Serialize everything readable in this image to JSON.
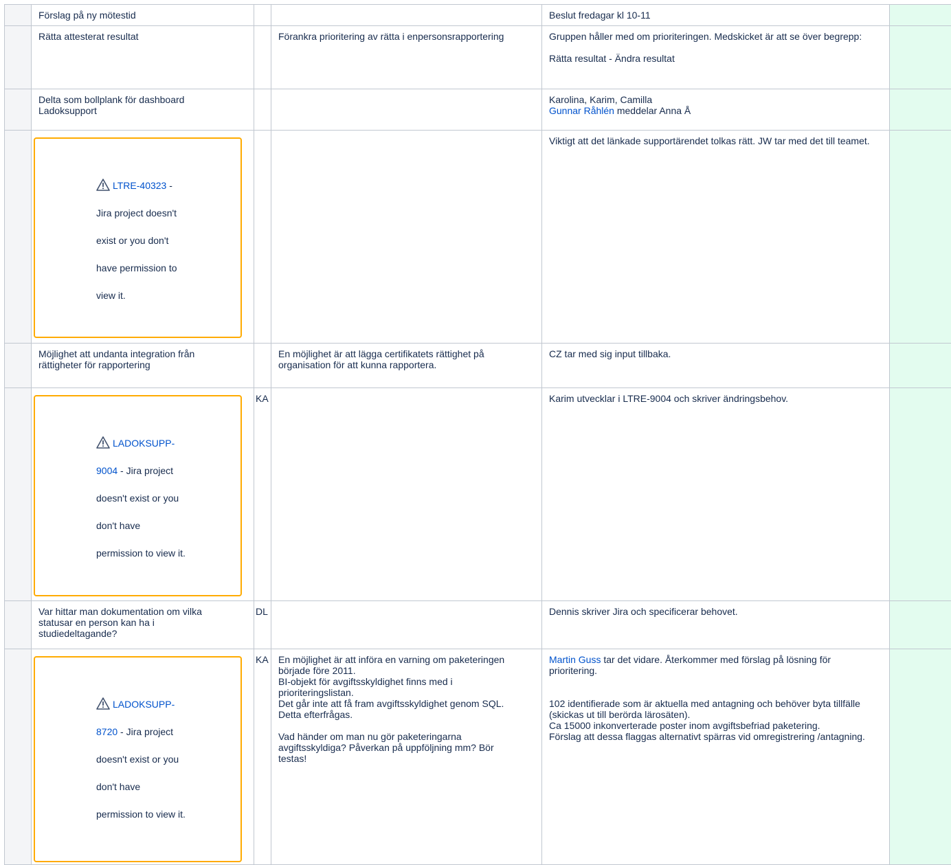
{
  "rows": [
    {
      "topic": "Förslag på ny mötestid",
      "who": "",
      "discussion": [],
      "decision": [
        {
          "text": "Beslut fredagar kl 10-11"
        }
      ]
    },
    {
      "topic": "Rätta attesterat resultat",
      "who": "",
      "discussion": [
        "Förankra prioritering av rätta i enpersonsrapportering"
      ],
      "decision": [
        {
          "text": "Gruppen håller med om prioriteringen. Medskicket är att se över begrepp:"
        },
        {
          "gap": true
        },
        {
          "text": "Rätta resultat - Ändra resultat"
        }
      ]
    },
    {
      "topic": "Delta som bollplank för dashboard Ladoksupport",
      "who": "",
      "discussion": [],
      "decision_line1": "Karolina, Karim, Camilla",
      "decision_link": "Gunnar Råhlén",
      "decision_after_link": " meddelar Anna Å"
    },
    {
      "jira_lines": [
        "LTRE-40323",
        " -",
        "Jira project doesn't",
        "exist or you don't",
        "have permission to",
        "view it."
      ],
      "who": "",
      "decision": "Viktigt att det länkade supportärendet tolkas rätt. JW tar med det till teamet."
    },
    {
      "topic": "Möjlighet att undanta integration från rättigheter för rapportering",
      "who": "",
      "discussion": "En möjlighet är att lägga certifikatets rättighet på organisation för att kunna rapportera.",
      "decision": "CZ tar med sig input tillbaka."
    },
    {
      "jira_lines": [
        "LADOKSUPP-",
        "9004",
        " - Jira project",
        "doesn't exist or you",
        "don't have",
        "permission to view it."
      ],
      "who": "KA",
      "decision": "Karim utvecklar i LTRE-9004 och skriver ändringsbehov."
    },
    {
      "topic": "Var hittar man dokumentation om vilka statusar en person kan ha i studiedeltagande?",
      "who": "DL",
      "decision": "Dennis skriver Jira och specificerar behovet."
    },
    {
      "jira_lines": [
        "LADOKSUPP-",
        "8720",
        " - Jira project",
        "doesn't exist or you",
        "don't have",
        "permission to view it."
      ],
      "who": "KA",
      "discussion": [
        "En möjlighet är att införa en varning om paketeringen började före 2011.",
        "BI-objekt för avgiftsskyldighet finns med i prioriteringslistan.",
        "Det går inte att få fram avgiftsskyldighet genom SQL. Detta efterfrågas.",
        "",
        "Vad händer om man nu gör paketeringarna avgiftsskyldiga? Påverkan på uppföljning mm? Bör testas!"
      ],
      "decision_link": "Martin Guss",
      "decision_after_link": " tar det vidare. Återkommer med förslag på lösning för prioritering.",
      "decision_rest": [
        "102 identifierade som är aktuella med antagning och behöver byta tillfälle (skickas ut till berörda lärosäten).",
        "Ca 15000 inkonverterade poster inom avgiftsbefriad paketering.",
        "Förslag att dessa flaggas alternativt spärras vid omregistrering /antagning."
      ]
    }
  ]
}
